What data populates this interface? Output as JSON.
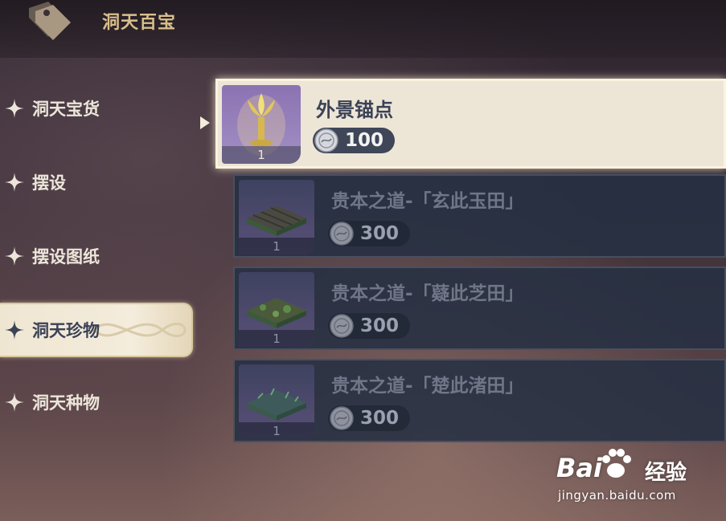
{
  "header": {
    "title": "洞天百宝",
    "icon": "price-tag-icon"
  },
  "sidebar": {
    "items": [
      {
        "label": "洞天宝货",
        "icon": "four-point-star-icon",
        "active": false
      },
      {
        "label": "摆设",
        "icon": "four-point-star-icon",
        "active": false
      },
      {
        "label": "摆设图纸",
        "icon": "four-point-star-icon",
        "active": false
      },
      {
        "label": "洞天珍物",
        "icon": "four-point-star-icon",
        "active": true
      },
      {
        "label": "洞天种物",
        "icon": "four-point-star-icon",
        "active": false
      }
    ]
  },
  "shop": {
    "items": [
      {
        "name": "外景锚点",
        "quantity": "1",
        "price": "100",
        "selected": true,
        "thumb_icon": "waypoint-anchor-icon"
      },
      {
        "name": "贵本之道-「玄此玉田」",
        "quantity": "1",
        "price": "300",
        "selected": false,
        "thumb_icon": "farm-plot-icon"
      },
      {
        "name": "贵本之道-「薿此芝田」",
        "quantity": "1",
        "price": "300",
        "selected": false,
        "thumb_icon": "farm-plot-icon"
      },
      {
        "name": "贵本之道-「楚此渚田」",
        "quantity": "1",
        "price": "300",
        "selected": false,
        "thumb_icon": "farm-plot-icon"
      }
    ],
    "currency_icon": "realm-currency-coin-icon"
  },
  "watermark": {
    "logo": "Bai",
    "cn": "经验",
    "url": "jingyan.baidu.com"
  },
  "colors": {
    "accent_gold": "#d9bf8c",
    "selected_bg": "#ede5d6",
    "card_bg": "#263042",
    "text_dark": "#3b4257"
  }
}
